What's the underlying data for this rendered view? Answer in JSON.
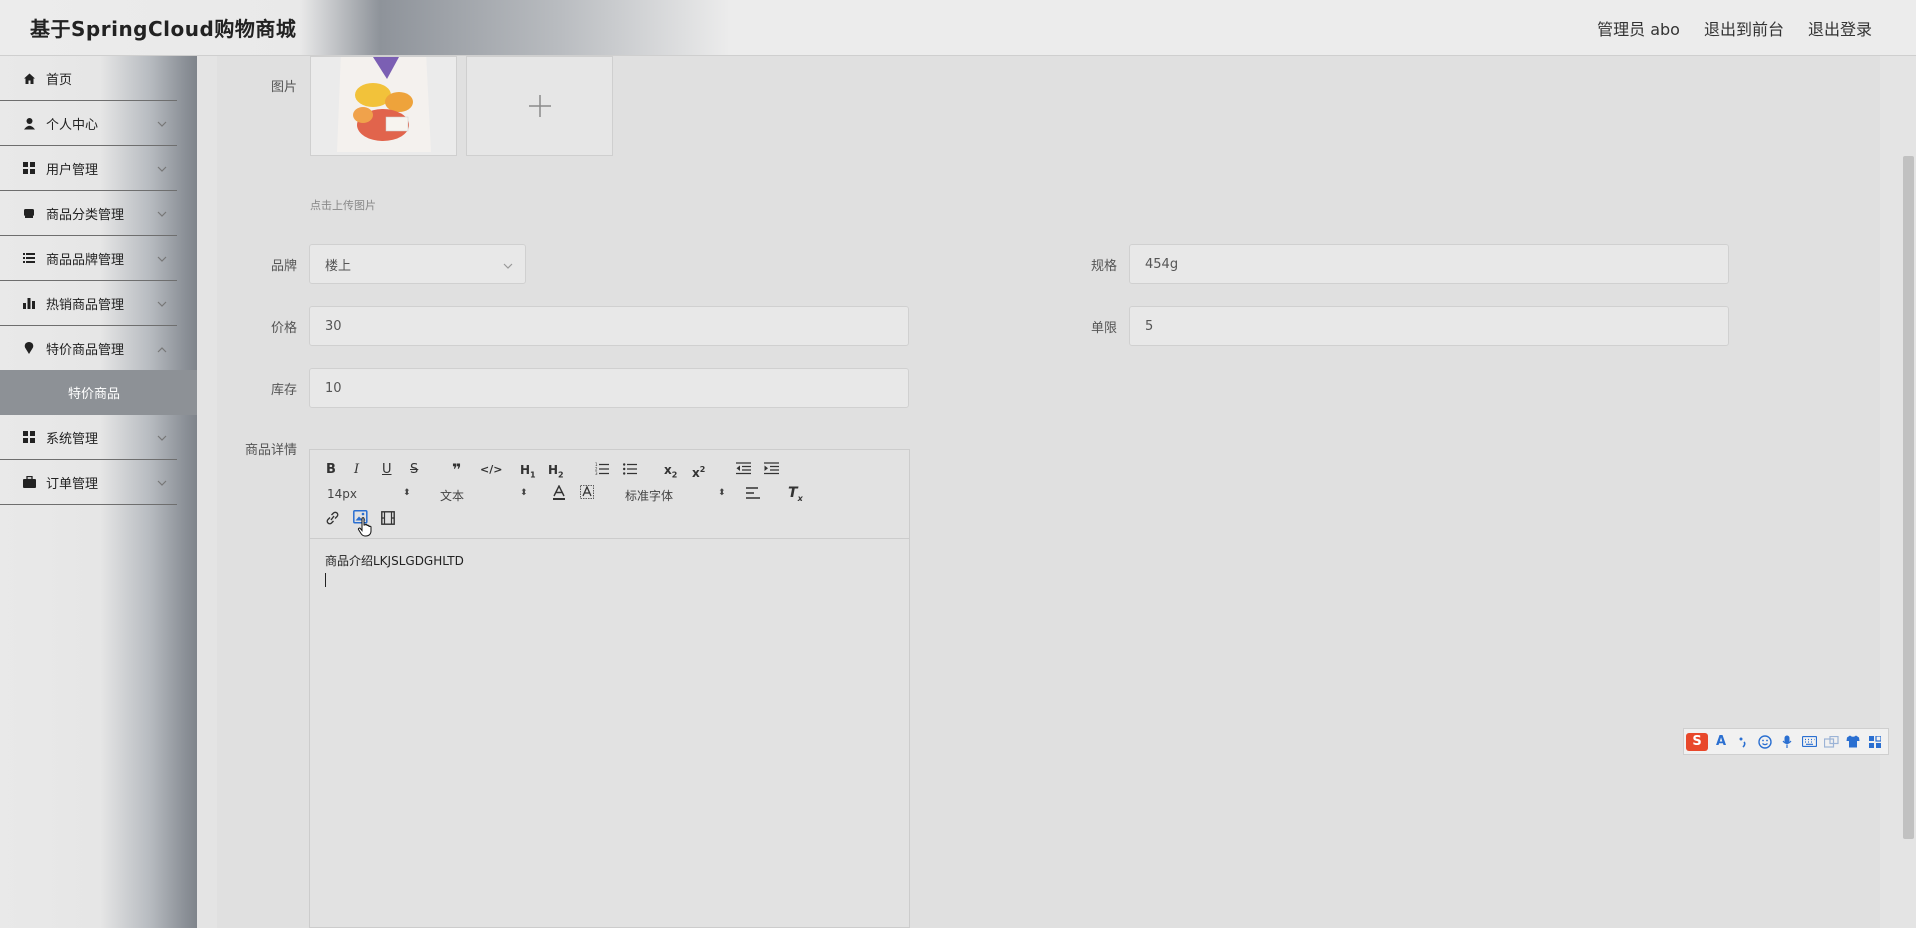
{
  "header": {
    "title": "基于SpringCloud购物商城",
    "admin": "管理员 abo",
    "to_front": "退出到前台",
    "logout": "退出登录"
  },
  "sidebar": {
    "items": [
      {
        "label": "首页",
        "icon": "home-icon"
      },
      {
        "label": "个人中心",
        "icon": "user-icon"
      },
      {
        "label": "用户管理",
        "icon": "grid-icon"
      },
      {
        "label": "商品分类管理",
        "icon": "box-icon"
      },
      {
        "label": "商品品牌管理",
        "icon": "list-icon"
      },
      {
        "label": "热销商品管理",
        "icon": "bar-chart-icon"
      },
      {
        "label": "特价商品管理",
        "icon": "pin-icon"
      },
      {
        "label": "系统管理",
        "icon": "grid-icon"
      },
      {
        "label": "订单管理",
        "icon": "briefcase-icon"
      }
    ],
    "active_sub": "特价商品"
  },
  "form": {
    "image_label": "图片",
    "upload_tip": "点击上传图片",
    "brand_label": "品牌",
    "brand_value": "楼上",
    "spec_label": "规格",
    "spec_value": "454g",
    "price_label": "价格",
    "price_value": "30",
    "limit_label": "单限",
    "limit_value": "5",
    "stock_label": "库存",
    "stock_value": "10",
    "detail_label": "商品详情"
  },
  "editor": {
    "font_size": "14px",
    "block_type": "文本",
    "font_family": "标准字体",
    "content": "商品介绍LKJSLGDGHLTD"
  },
  "ime": {
    "logo": "S",
    "letter": "A"
  }
}
